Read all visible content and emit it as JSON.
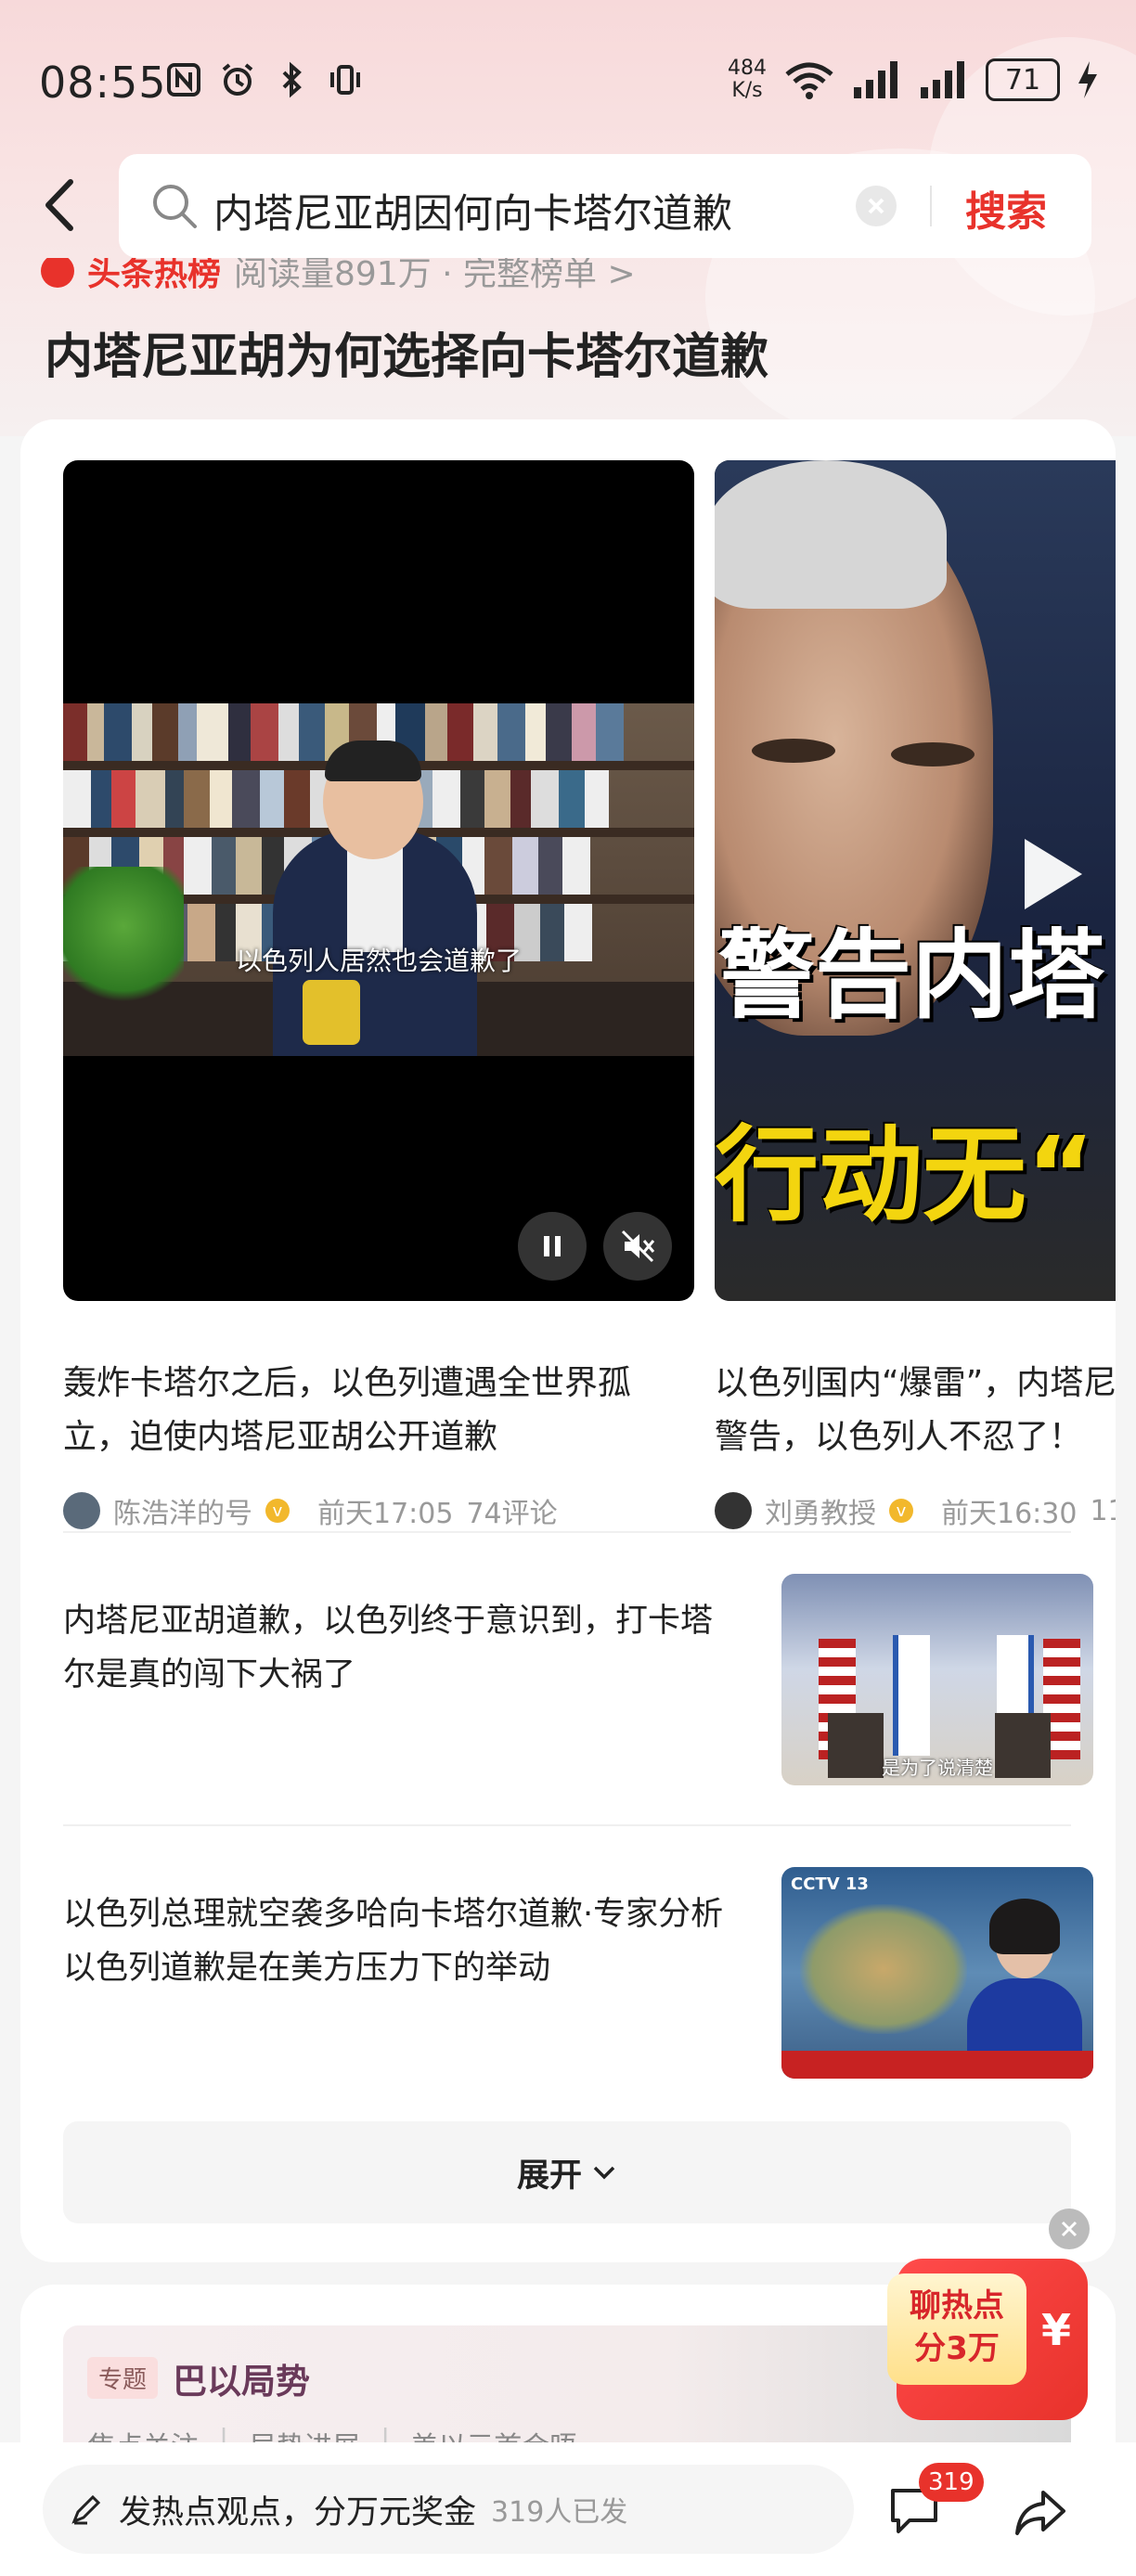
{
  "status_bar": {
    "time": "08:55",
    "net_speed_value": "484",
    "net_speed_unit": "K/s",
    "battery": "71"
  },
  "search": {
    "query": "内塔尼亚胡因何向卡塔尔道歉",
    "button_label": "搜索"
  },
  "hot": {
    "brand": "头条热榜",
    "meta": "阅读量891万 · 完整榜单 >"
  },
  "page_title": "内塔尼亚胡为何选择向卡塔尔道歉",
  "videos": [
    {
      "subtitle": "以色列人居然也会道歉了",
      "title": "轰炸卡塔尔之后，以色列遭遇全世界孤立，迫使内塔尼亚胡公开道歉",
      "author": "陈浩洋的号",
      "time": "前天17:05",
      "comments": "74评论"
    },
    {
      "overlay_text_1": "警告内塔",
      "overlay_text_2": "行动无“",
      "title": "以色列国内“爆雷”，内塔尼",
      "title_line2": "警告，以色列人不忍了！",
      "author": "刘勇教授",
      "time": "前天16:30",
      "comments": "11"
    }
  ],
  "news": [
    {
      "title": "内塔尼亚胡道歉，以色列终于意识到，打卡塔尔是真的闯下大祸了",
      "thumb_caption": "是为了说清楚"
    },
    {
      "title": "以色列总理就空袭多哈向卡塔尔道歉·专家分析 以色列道歉是在美方压力下的举动",
      "thumb_logo": "CCTV 13"
    }
  ],
  "expand_label": "展开",
  "topic": {
    "tag": "专题",
    "title": "巴以局势",
    "links": [
      "焦点关注",
      "局势进展",
      "美以元首会晤"
    ]
  },
  "promo": {
    "line1": "聊热点",
    "line2": "分3万",
    "yen": "¥"
  },
  "bottom": {
    "input_text": "发热点观点，分万元奖金",
    "input_count": "319人已发",
    "comment_count": "319"
  },
  "colors": {
    "accent": "#e8322b",
    "verified": "#f2b82c"
  }
}
